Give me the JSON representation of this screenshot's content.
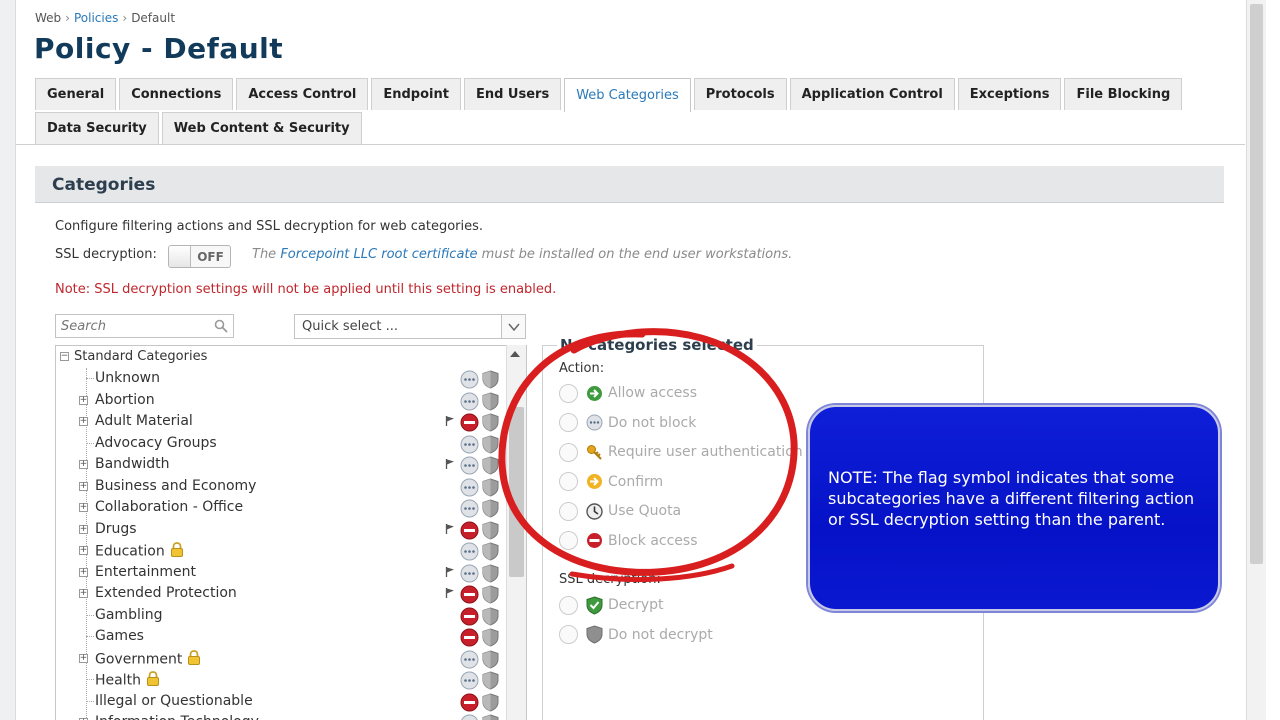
{
  "breadcrumb": {
    "root": "Web",
    "link": "Policies",
    "current": "Default",
    "separator": "›"
  },
  "page_title": "Policy - Default",
  "tabs_row1": [
    "General",
    "Connections",
    "Access Control",
    "Endpoint",
    "End Users",
    "Web Categories",
    "Protocols",
    "Application Control",
    "Exceptions",
    "File Blocking"
  ],
  "tabs_row2": [
    "Data Security",
    "Web Content & Security"
  ],
  "active_tab": "Web Categories",
  "section": {
    "title": "Categories"
  },
  "description": "Configure filtering actions and SSL decryption for web categories.",
  "ssl": {
    "label": "SSL decryption:",
    "toggle_state": "OFF",
    "info_prefix": "The",
    "info_link": "Forcepoint LLC root certificate",
    "info_suffix": "must be installed on the end user workstations."
  },
  "note": "Note: SSL decryption settings will not be applied until this setting is enabled.",
  "search": {
    "placeholder": "Search"
  },
  "quick_select": {
    "value": "Quick select ..."
  },
  "tree": {
    "root": "Standard Categories",
    "items": [
      {
        "name": "Unknown",
        "expandable": false,
        "lock": false,
        "flag": false,
        "action": "permit"
      },
      {
        "name": "Abortion",
        "expandable": true,
        "lock": false,
        "flag": false,
        "action": "permit"
      },
      {
        "name": "Adult Material",
        "expandable": true,
        "lock": false,
        "flag": true,
        "action": "block"
      },
      {
        "name": "Advocacy Groups",
        "expandable": false,
        "lock": false,
        "flag": false,
        "action": "permit"
      },
      {
        "name": "Bandwidth",
        "expandable": true,
        "lock": false,
        "flag": true,
        "action": "permit"
      },
      {
        "name": "Business and Economy",
        "expandable": true,
        "lock": false,
        "flag": false,
        "action": "permit"
      },
      {
        "name": "Collaboration - Office",
        "expandable": true,
        "lock": false,
        "flag": false,
        "action": "permit"
      },
      {
        "name": "Drugs",
        "expandable": true,
        "lock": false,
        "flag": true,
        "action": "block"
      },
      {
        "name": "Education",
        "expandable": true,
        "lock": true,
        "flag": false,
        "action": "permit"
      },
      {
        "name": "Entertainment",
        "expandable": true,
        "lock": false,
        "flag": true,
        "action": "permit"
      },
      {
        "name": "Extended Protection",
        "expandable": true,
        "lock": false,
        "flag": true,
        "action": "block"
      },
      {
        "name": "Gambling",
        "expandable": false,
        "lock": false,
        "flag": false,
        "action": "block"
      },
      {
        "name": "Games",
        "expandable": false,
        "lock": false,
        "flag": false,
        "action": "block"
      },
      {
        "name": "Government",
        "expandable": true,
        "lock": true,
        "flag": false,
        "action": "permit"
      },
      {
        "name": "Health",
        "expandable": false,
        "lock": true,
        "flag": false,
        "action": "permit"
      },
      {
        "name": "Illegal or Questionable",
        "expandable": false,
        "lock": false,
        "flag": false,
        "action": "block"
      },
      {
        "name": "Information Technology",
        "expandable": true,
        "lock": false,
        "flag": false,
        "action": "permit"
      }
    ]
  },
  "panel": {
    "title": "No categories selected",
    "action_label": "Action:",
    "actions": [
      {
        "label": "Allow access",
        "icon": "allow-icon"
      },
      {
        "label": "Do not block",
        "icon": "do-not-block-icon"
      },
      {
        "label": "Require user authentication",
        "icon": "key-icon"
      },
      {
        "label": "Confirm",
        "icon": "confirm-icon"
      },
      {
        "label": "Use Quota",
        "icon": "quota-clock-icon"
      },
      {
        "label": "Block access",
        "icon": "block-icon"
      }
    ],
    "ssl_label": "SSL decryption:",
    "ssl_options": [
      {
        "label": "Decrypt",
        "icon": "decrypt-shield-icon"
      },
      {
        "label": "Do not decrypt",
        "icon": "do-not-decrypt-shield-icon"
      }
    ]
  },
  "callout": {
    "text": "NOTE: The flag symbol indicates that some subcategories have a different filtering action or SSL decryption setting than the parent."
  },
  "colors": {
    "title": "#123a5a",
    "link": "#2a79b9",
    "note_red": "#c0262d",
    "callout_blue": "#0512c7",
    "annotation_red": "#d81e1e"
  }
}
